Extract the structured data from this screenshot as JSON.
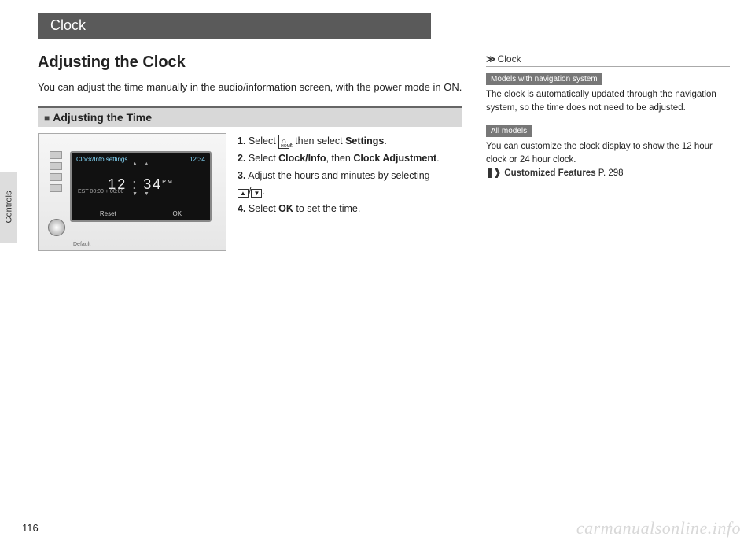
{
  "header": {
    "title": "Clock"
  },
  "tab": {
    "label": "Controls"
  },
  "main": {
    "title": "Adjusting the Clock",
    "intro": "You can adjust the time manually in the audio/information screen, with the power mode in ON.",
    "subheading": "Adjusting the Time",
    "figure": {
      "screen_title": "Clock/Info settings",
      "corner_time": "12:34",
      "timezone": "EST 00:00 + 00:00",
      "hh": "12",
      "mm": "34",
      "ampm": "PM",
      "btn_reset": "Reset",
      "btn_ok": "OK",
      "bottom_label": "Default"
    },
    "steps": {
      "s1_a": "Select ",
      "s1_b": ", then select ",
      "s1_bold": "Settings",
      "s1_c": ".",
      "s2_a": "Select ",
      "s2_bold1": "Clock/Info",
      "s2_b": ", then ",
      "s2_bold2": "Clock Adjustment",
      "s2_c": ".",
      "s3_a": "Adjust the hours and minutes by selecting ",
      "s3_b": "/",
      "s3_c": ".",
      "s4_a": "Select ",
      "s4_bold": "OK",
      "s4_b": " to set the time."
    }
  },
  "sidebar": {
    "head": "Clock",
    "tag1": "Models with navigation system",
    "p1": "The clock is automatically updated through the navigation system, so the time does not need to be adjusted.",
    "tag2": "All models",
    "p2": "You can customize the clock display to show the 12 hour clock or 24 hour clock.",
    "ref_label": "Customized Features",
    "ref_page": "P. 298"
  },
  "page_number": "116",
  "watermark": "carmanualsonline.info"
}
